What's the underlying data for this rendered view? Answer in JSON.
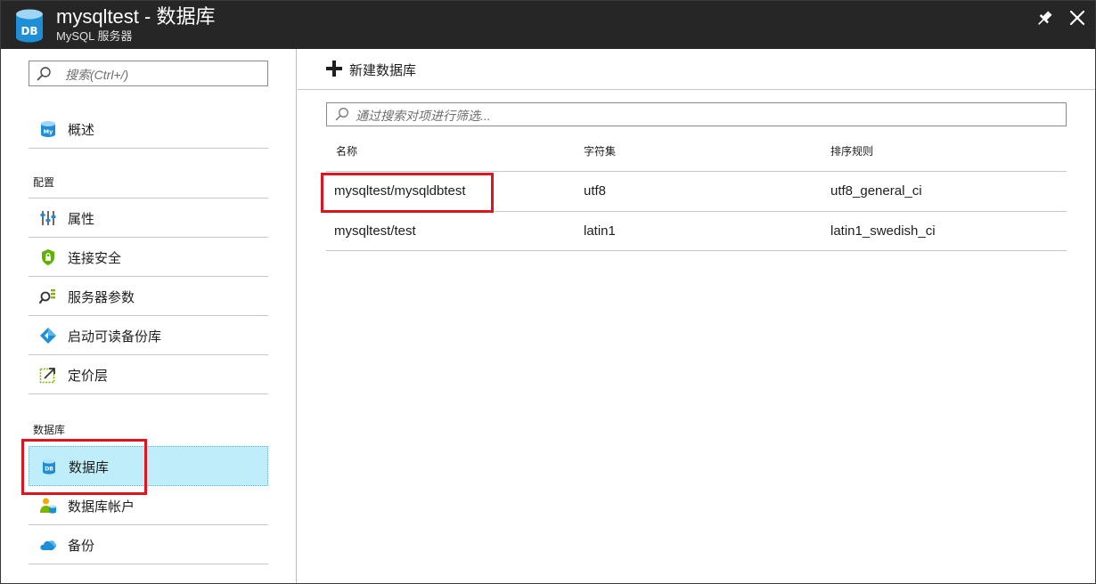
{
  "window": {
    "title": "mysqltest - 数据库",
    "subtitle": "MySQL 服务器",
    "app_icon_text": "DB",
    "icons": {
      "app": "database-db-icon",
      "pin": "pin-icon",
      "close": "close-icon"
    }
  },
  "sidebar": {
    "search_placeholder": "搜索(Ctrl+/)",
    "overview": {
      "label": "概述",
      "icon": "mysql-db-icon"
    },
    "sections": [
      {
        "title": "配置",
        "items": [
          {
            "label": "属性",
            "icon": "properties-sliders-icon"
          },
          {
            "label": "连接安全",
            "icon": "shield-lock-icon"
          },
          {
            "label": "服务器参数",
            "icon": "server-parameters-icon"
          },
          {
            "label": "启动可读备份库",
            "icon": "replica-diamond-icon"
          },
          {
            "label": "定价层",
            "icon": "pricing-tier-icon"
          }
        ]
      },
      {
        "title": "数据库",
        "items": [
          {
            "label": "数据库",
            "icon": "database-icon",
            "selected": true
          },
          {
            "label": "数据库帐户",
            "icon": "database-accounts-icon"
          },
          {
            "label": "备份",
            "icon": "cloud-backup-icon"
          }
        ]
      }
    ]
  },
  "main": {
    "new_database_label": "新建数据库",
    "filter_placeholder": "通过搜索对项进行筛选...",
    "columns": [
      "名称",
      "字符集",
      "排序规则"
    ],
    "rows": [
      {
        "name": "mysqltest/mysqldbtest",
        "charset": "utf8",
        "collation": "utf8_general_ci"
      },
      {
        "name": "mysqltest/test",
        "charset": "latin1",
        "collation": "latin1_swedish_ci"
      }
    ]
  },
  "colors": {
    "titlebar": "#262626",
    "selected_bg": "#bfeefa",
    "highlight": "#e0141e",
    "azure_blue": "#1e8fd6"
  }
}
